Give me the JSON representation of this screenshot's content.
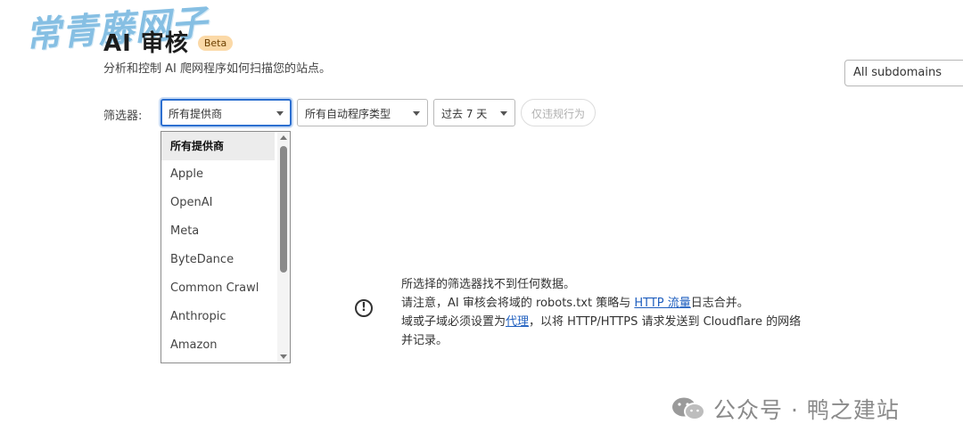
{
  "watermark": "常青藤网子",
  "header": {
    "title": "AI 审核",
    "badge": "Beta",
    "subtitle": "分析和控制 AI 爬网程序如何扫描您的站点。"
  },
  "subdomain_select": {
    "value": "All subdomains"
  },
  "filters": {
    "label": "筛选器:",
    "provider_select": "所有提供商",
    "bot_type_select": "所有自动程序类型",
    "time_select": "过去 7 天",
    "violation_button": "仅违规行为"
  },
  "dropdown": {
    "options": [
      "所有提供商",
      "Apple",
      "OpenAI",
      "Meta",
      "ByteDance",
      "Common Crawl",
      "Anthropic",
      "Amazon"
    ],
    "selected_index": 0
  },
  "empty_state": {
    "line1": "所选择的筛选器找不到任何数据。",
    "line2_pre": "请注意，AI 审核会将域的 robots.txt 策略与 ",
    "line2_link": "HTTP 流量",
    "line2_post": "日志合并。",
    "line3_pre": "域或子域必须设置为",
    "line3_link": "代理",
    "line3_post": "，以将 HTTP/HTTPS 请求发送到 Cloudflare 的网络",
    "line4": "并记录。"
  },
  "brand": {
    "text": "公众号 · 鸭之建站"
  },
  "icons": {
    "info": "info-circle-icon",
    "wechat": "wechat-icon",
    "caret": "chevron-down-icon"
  },
  "colors": {
    "accent": "#2c6fd0",
    "link": "#1f5fbf",
    "badge_bg": "#fbd9a7"
  }
}
